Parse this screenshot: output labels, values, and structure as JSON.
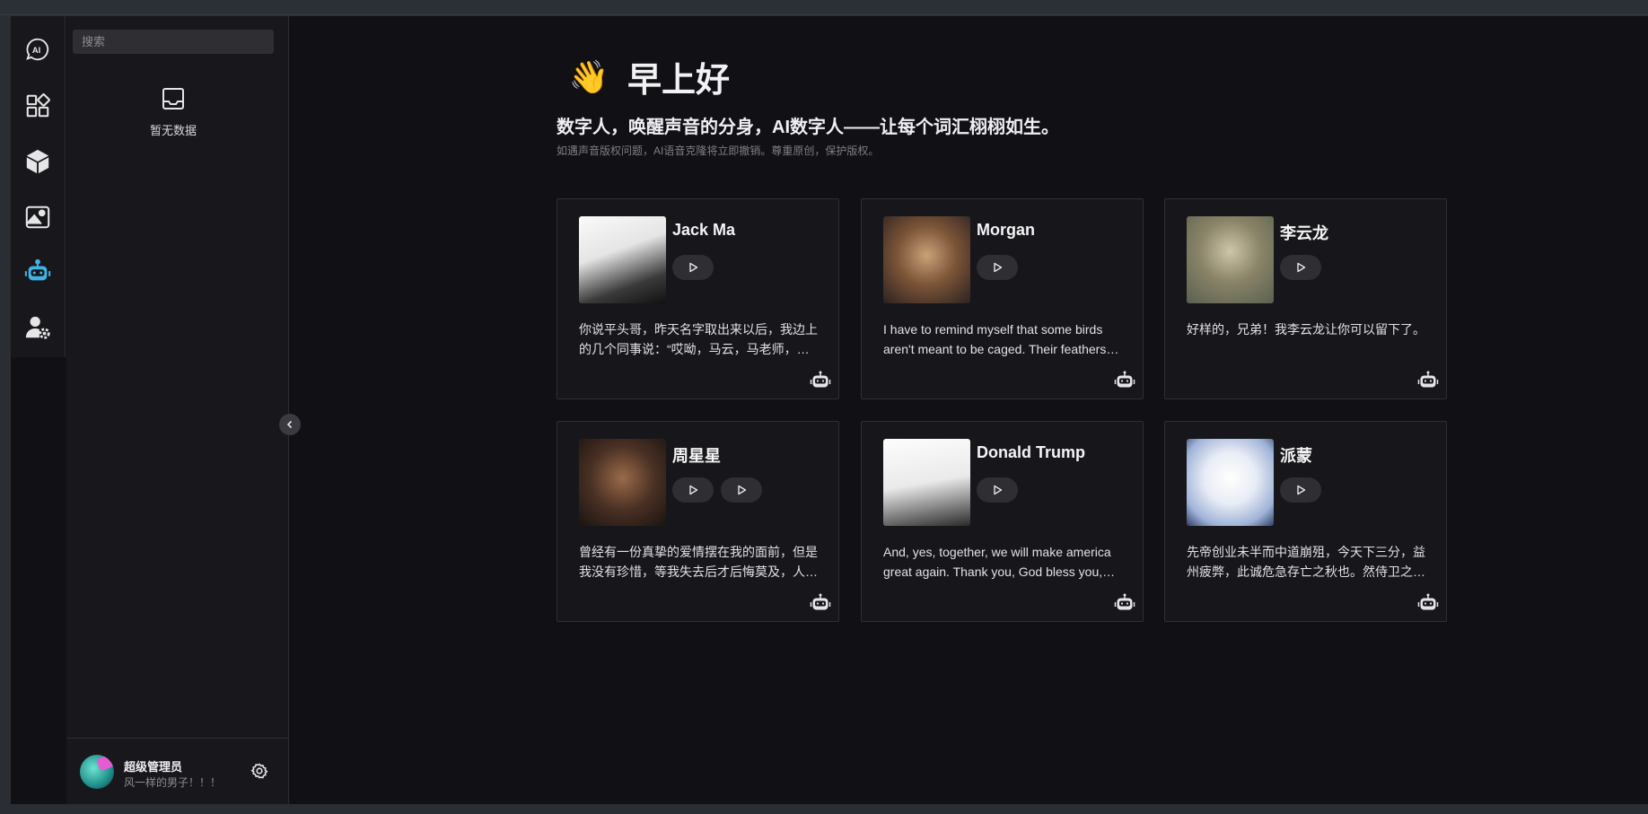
{
  "sidebar": {
    "nav": [
      {
        "icon": "ai-chat-icon",
        "active": false
      },
      {
        "icon": "apps-grid-icon",
        "active": false
      },
      {
        "icon": "cube-icon",
        "active": false
      },
      {
        "icon": "image-icon",
        "active": false
      },
      {
        "icon": "robot-icon",
        "active": true
      },
      {
        "icon": "user-settings-icon",
        "active": false
      }
    ],
    "search_placeholder": "搜索",
    "empty_text": "暂无数据"
  },
  "user": {
    "name": "超级管理员",
    "motto": "风一样的男子！！！"
  },
  "greeting": {
    "emoji": "👋",
    "title": "早上好",
    "subtitle": "数字人，唤醒声音的分身，AI数字人——让每个词汇栩栩如生。",
    "notice": "如遇声音版权问题，AI语音克隆将立即撤销。尊重原创，保护版权。"
  },
  "voices": [
    {
      "name": "Jack Ma",
      "plays": 1,
      "quote": "你说平头哥，昨天名字取出来以后，我边上的几个同事说：“哎呦，马云，马老师，你这个名字取得太好了”"
    },
    {
      "name": "Morgan",
      "plays": 1,
      "quote": "I have to remind myself that some birds aren't meant to be caged. Their feathers are just too bright."
    },
    {
      "name": "李云龙",
      "plays": 1,
      "quote": "好样的，兄弟！我李云龙让你可以留下了。"
    },
    {
      "name": "周星星",
      "plays": 2,
      "quote": "曾经有一份真挚的爱情摆在我的面前，但是我没有珍惜，等我失去后才后悔莫及，人世间最痛苦的事莫过于此。"
    },
    {
      "name": "Donald Trump",
      "plays": 1,
      "quote": "And, yes, together, we will make america great again. Thank you, God bless you, and God bless America."
    },
    {
      "name": "派蒙",
      "plays": 1,
      "quote": "先帝创业未半而中道崩殂，今天下三分，益州疲弊，此诚危急存亡之秋也。然侍卫之臣不懈于内。"
    }
  ],
  "colors": {
    "accent": "#3fb3e6",
    "background": "#111115",
    "panel": "#18181c",
    "card": "#17171b"
  }
}
